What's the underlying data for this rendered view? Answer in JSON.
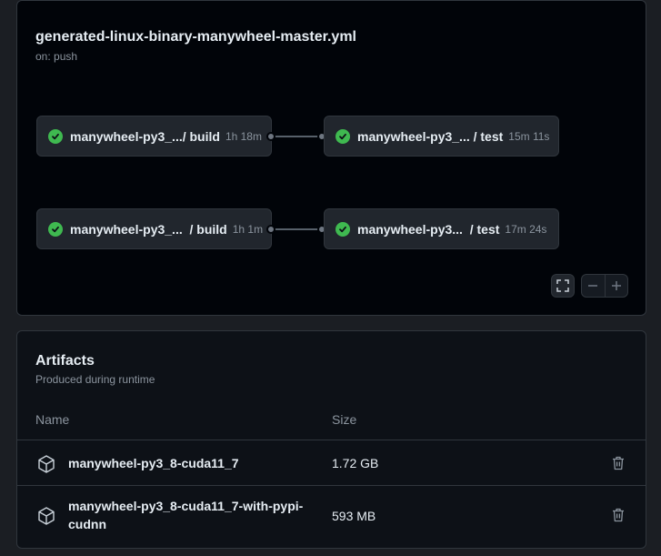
{
  "workflow": {
    "title": "generated-linux-binary-manywheel-master.yml",
    "trigger": "on: push",
    "jobs": [
      {
        "name": "manywheel-py3_.../ build",
        "duration": "1h 18m",
        "status": "success"
      },
      {
        "name": "manywheel-py3_... / test",
        "duration": "15m 11s",
        "status": "success"
      },
      {
        "name": "manywheel-py3_...  / build",
        "duration": "1h 1m",
        "status": "success"
      },
      {
        "name": "manywheel-py3...  / test",
        "duration": "17m 24s",
        "status": "success"
      }
    ],
    "controls": {
      "fullscreen_icon": "fullscreen-icon",
      "zoom_out_icon": "minus-icon",
      "zoom_in_icon": "plus-icon"
    }
  },
  "artifacts": {
    "title": "Artifacts",
    "subtitle": "Produced during runtime",
    "columns": {
      "name": "Name",
      "size": "Size"
    },
    "items": [
      {
        "name": "manywheel-py3_8-cuda11_7",
        "size": "1.72 GB"
      },
      {
        "name": "manywheel-py3_8-cuda11_7-with-pypi-cudnn",
        "name_line1": "manywheel-py3_8-cuda11_7-with-pypi-",
        "name_line2": "cudnn",
        "size": "593 MB"
      }
    ]
  },
  "colors": {
    "success": "#3fb950",
    "panel_bg": "#010409",
    "border": "#30363d"
  }
}
